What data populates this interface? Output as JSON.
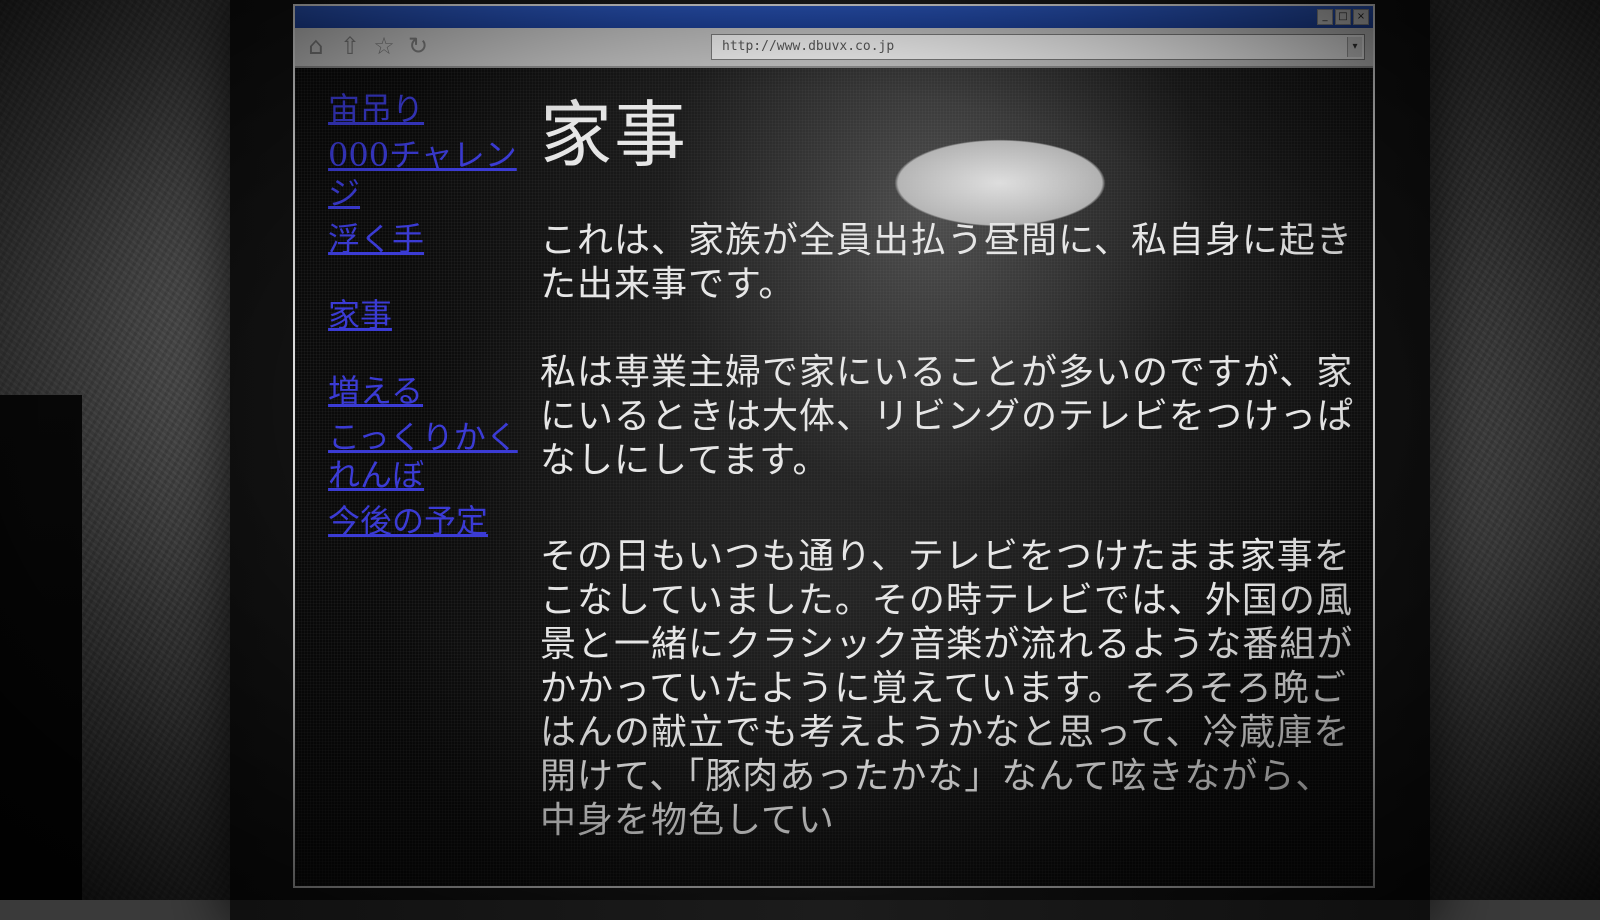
{
  "browser": {
    "address": "http://www.dbuvx.co.jp",
    "nav_icons": [
      "home-icon",
      "up-icon",
      "bookmark-icon",
      "reload-icon"
    ],
    "window_buttons": [
      "minimize-icon",
      "maximize-icon",
      "close-icon"
    ]
  },
  "sidebar": {
    "items": [
      {
        "label": "宙吊り"
      },
      {
        "label": "000チャレンジ"
      },
      {
        "label": "浮く手"
      },
      {
        "label": "家事"
      },
      {
        "label": "増える"
      },
      {
        "label": "こっくりかくれんぼ"
      },
      {
        "label": "今後の予定"
      }
    ]
  },
  "article": {
    "title": "家事",
    "paragraphs": [
      "これは、家族が全員出払う昼間に、私自身に起きた出来事です。",
      "私は専業主婦で家にいることが多いのですが、家にいるときは大体、リビングのテレビをつけっぱなしにしてます。",
      "その日もいつも通り、テレビをつけたまま家事をこなしていました。その時テレビでは、外国の風景と一緒にクラシック音楽が流れるような番組がかかっていたように覚えています。そろそろ晩ごはんの献立でも考えようかなと思って、冷蔵庫を開けて、「豚肉あったかな」なんて呟きながら、中身を物色してい"
    ]
  },
  "colors": {
    "link": "#3b3bd4",
    "text": "#e6e6e6",
    "titlebar": "#2a55b8"
  }
}
